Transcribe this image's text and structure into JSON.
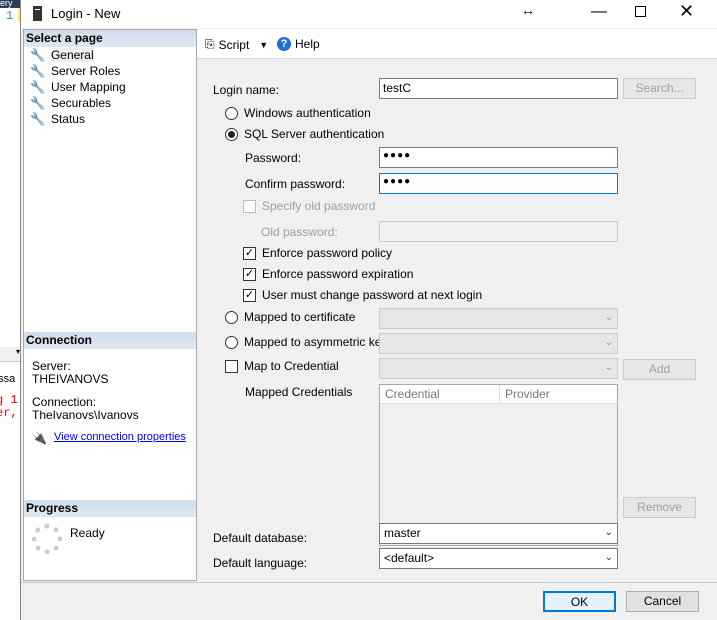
{
  "background": {
    "fragments": [
      "ery",
      "1",
      "essa",
      "g 1",
      "er,"
    ]
  },
  "window": {
    "title": "Login - New",
    "controls": [
      "resize",
      "minimize",
      "maximize",
      "close"
    ]
  },
  "left": {
    "select_page": "Select a page",
    "pages": [
      "General",
      "Server Roles",
      "User Mapping",
      "Securables",
      "Status"
    ],
    "connection_header": "Connection",
    "server_label": "Server:",
    "server_value": "THEIVANOVS",
    "connection_label": "Connection:",
    "connection_value": "TheIvanovs\\Ivanovs",
    "view_link": "View connection properties",
    "progress_header": "Progress",
    "progress_status": "Ready"
  },
  "toolbar": {
    "script": "Script",
    "help": "Help"
  },
  "form": {
    "login_name_label": "Login name:",
    "login_name_value": "testC",
    "search": "Search...",
    "windows_auth": "Windows authentication",
    "sql_auth": "SQL Server authentication",
    "password_label": "Password:",
    "password_value": "●●●●",
    "confirm_label": "Confirm password:",
    "confirm_value": "●●●●",
    "specify_old": "Specify old password",
    "old_password_label": "Old password:",
    "enforce_policy": "Enforce password policy",
    "enforce_expiration": "Enforce password expiration",
    "must_change": "User must change password at next login",
    "mapped_cert": "Mapped to certificate",
    "mapped_asym": "Mapped to asymmetric key",
    "map_credential": "Map to Credential",
    "add": "Add",
    "mapped_credentials": "Mapped Credentials",
    "columns": [
      "Credential",
      "Provider"
    ],
    "remove": "Remove",
    "default_db_label": "Default database:",
    "default_db_value": "master",
    "default_lang_label": "Default language:",
    "default_lang_value": "<default>"
  },
  "footer": {
    "ok": "OK",
    "cancel": "Cancel"
  },
  "colors": {
    "accent": "#0078d7",
    "link": "#0000ee",
    "header": "#d4e0ee"
  }
}
